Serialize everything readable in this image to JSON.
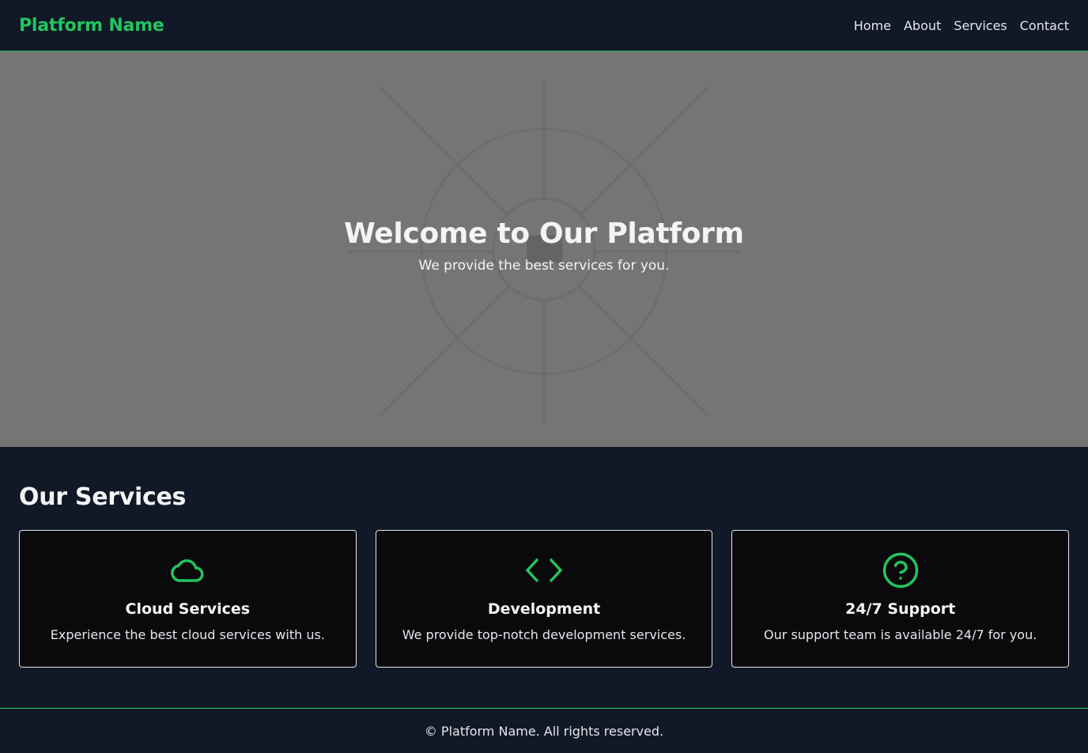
{
  "header": {
    "brand": "Platform Name",
    "nav": [
      "Home",
      "About",
      "Services",
      "Contact"
    ]
  },
  "hero": {
    "title": "Welcome to Our Platform",
    "subtitle": "We provide the best services for you.",
    "background_icon": "image-placeholder-icon"
  },
  "services": {
    "title": "Our Services",
    "cards": [
      {
        "icon": "cloud-icon",
        "title": "Cloud Services",
        "description": "Experience the best cloud services with us."
      },
      {
        "icon": "code-icon",
        "title": "Development",
        "description": "We provide top-notch development services."
      },
      {
        "icon": "help-circle-icon",
        "title": "24/7 Support",
        "description": "Our support team is available 24/7 for you."
      }
    ]
  },
  "footer": {
    "text": "© Platform Name. All rights reserved."
  },
  "colors": {
    "accent": "#22c55e",
    "background": "#111827",
    "card_background": "#0a0a0c",
    "hero_background": "#757575"
  }
}
